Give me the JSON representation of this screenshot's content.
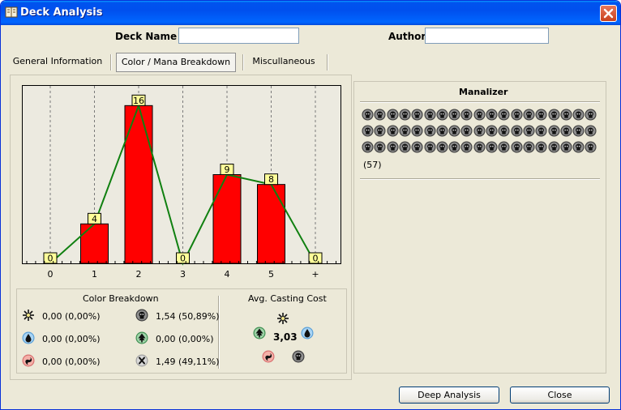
{
  "window": {
    "title": "Deck Analysis"
  },
  "header": {
    "deck_name_label": "Deck Name",
    "deck_name_value": "",
    "author_label": "Author",
    "author_value": ""
  },
  "tabs": [
    {
      "label": "General Information",
      "active": false
    },
    {
      "label": "Color / Mana Breakdown",
      "active": true
    },
    {
      "label": "Miscullaneous",
      "active": false
    }
  ],
  "chart_data": {
    "type": "bar",
    "categories": [
      "0",
      "1",
      "2",
      "3",
      "4",
      "5",
      "+"
    ],
    "values": [
      0,
      4,
      16,
      0,
      9,
      8,
      0
    ],
    "data_labels": [
      "0",
      "4",
      "16",
      "0",
      "9",
      "8",
      "0"
    ],
    "ylim": [
      0,
      18
    ],
    "grid": "vertical-dashed",
    "bar_color": "#ff0000",
    "line_color": "#108010"
  },
  "color_breakdown": {
    "title": "Color Breakdown",
    "items": [
      {
        "icon": "white-mana-icon",
        "value": "0,00 (0,00%)"
      },
      {
        "icon": "black-mana-icon",
        "value": "1,54 (50,89%)"
      },
      {
        "icon": "blue-mana-icon",
        "value": "0,00 (0,00%)"
      },
      {
        "icon": "green-mana-icon",
        "value": "0,00 (0,00%)"
      },
      {
        "icon": "red-mana-icon",
        "value": "0,00 (0,00%)"
      },
      {
        "icon": "colorless-mana-icon",
        "value": "1,49 (49,11%)"
      }
    ]
  },
  "avg_casting_cost": {
    "title": "Avg. Casting Cost",
    "value": "3,03"
  },
  "manalizer": {
    "title": "Manalizer",
    "symbol_icon": "black-mana-icon",
    "symbol_count": 57,
    "count_label": "(57)"
  },
  "buttons": {
    "deep_analysis": "Deep Analysis",
    "close": "Close"
  },
  "colors": {
    "title_bar": "#0054e3",
    "window_bg": "#ece9d8",
    "bar": "#ff0000",
    "curve": "#108010",
    "label_bg": "#ffff99"
  }
}
